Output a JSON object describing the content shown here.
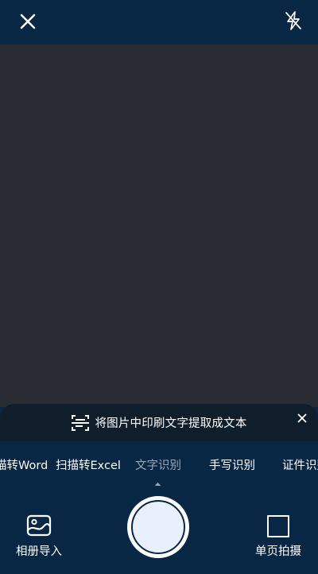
{
  "topbar": {
    "close_icon": "close-icon",
    "flash_icon": "flash-off-icon"
  },
  "hint": {
    "icon": "scan-text-icon",
    "text": "将图片中印刷文字提取成文本",
    "close_icon": "close-icon"
  },
  "modes": {
    "items": [
      {
        "label": "描转Word"
      },
      {
        "label": "扫描转Excel"
      },
      {
        "label": "文字识别"
      },
      {
        "label": "手写识别"
      },
      {
        "label": "证件识别"
      }
    ],
    "active_index": 2
  },
  "actions": {
    "album_label": "相册导入",
    "single_label": "单页拍摄"
  },
  "colors": {
    "background": "#072744",
    "viewfinder": "#292d33",
    "hint_bar": "#101e2c",
    "active_mode": "#9aa8b8"
  }
}
